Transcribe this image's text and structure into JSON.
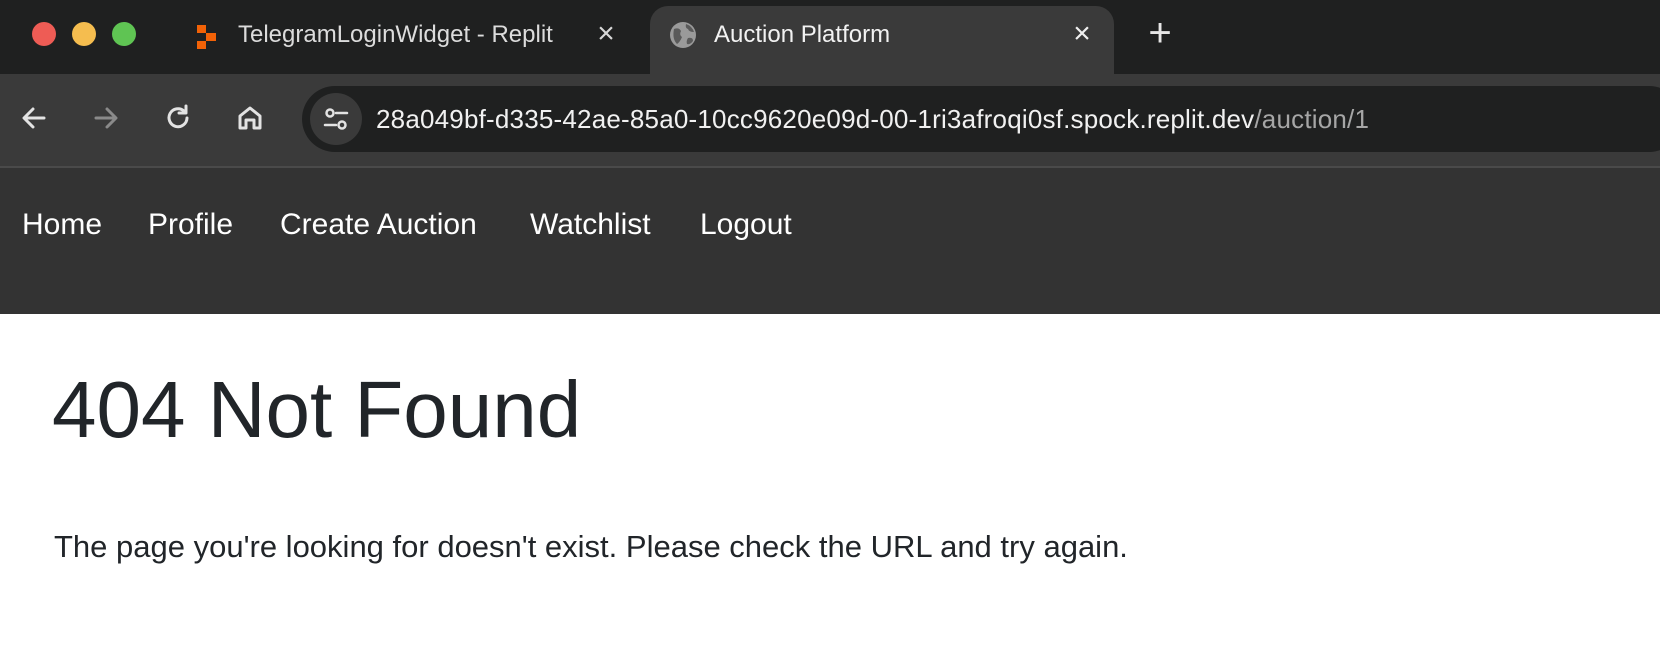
{
  "browser": {
    "tabs": [
      {
        "label": "TelegramLoginWidget - Replit",
        "favicon": "replit-logo-icon",
        "active": false
      },
      {
        "label": "Auction Platform",
        "favicon": "globe-icon",
        "active": true
      }
    ],
    "new_tab_label": "+",
    "url": {
      "host": "28a049bf-d335-42ae-85a0-10cc9620e09d-00-1ri3afroqi0sf.spock.replit.dev",
      "path": "/auction/1"
    },
    "colors": {
      "tabstrip": "#1f2020",
      "toolbar": "#3a3a3a",
      "replit_orange": "#f26207"
    }
  },
  "site_nav": {
    "links": [
      "Home",
      "Profile",
      "Create Auction",
      "Watchlist",
      "Logout"
    ],
    "background": "#333333"
  },
  "page": {
    "title": "404 Not Found",
    "message": "The page you're looking for doesn't exist. Please check the URL and try again."
  }
}
